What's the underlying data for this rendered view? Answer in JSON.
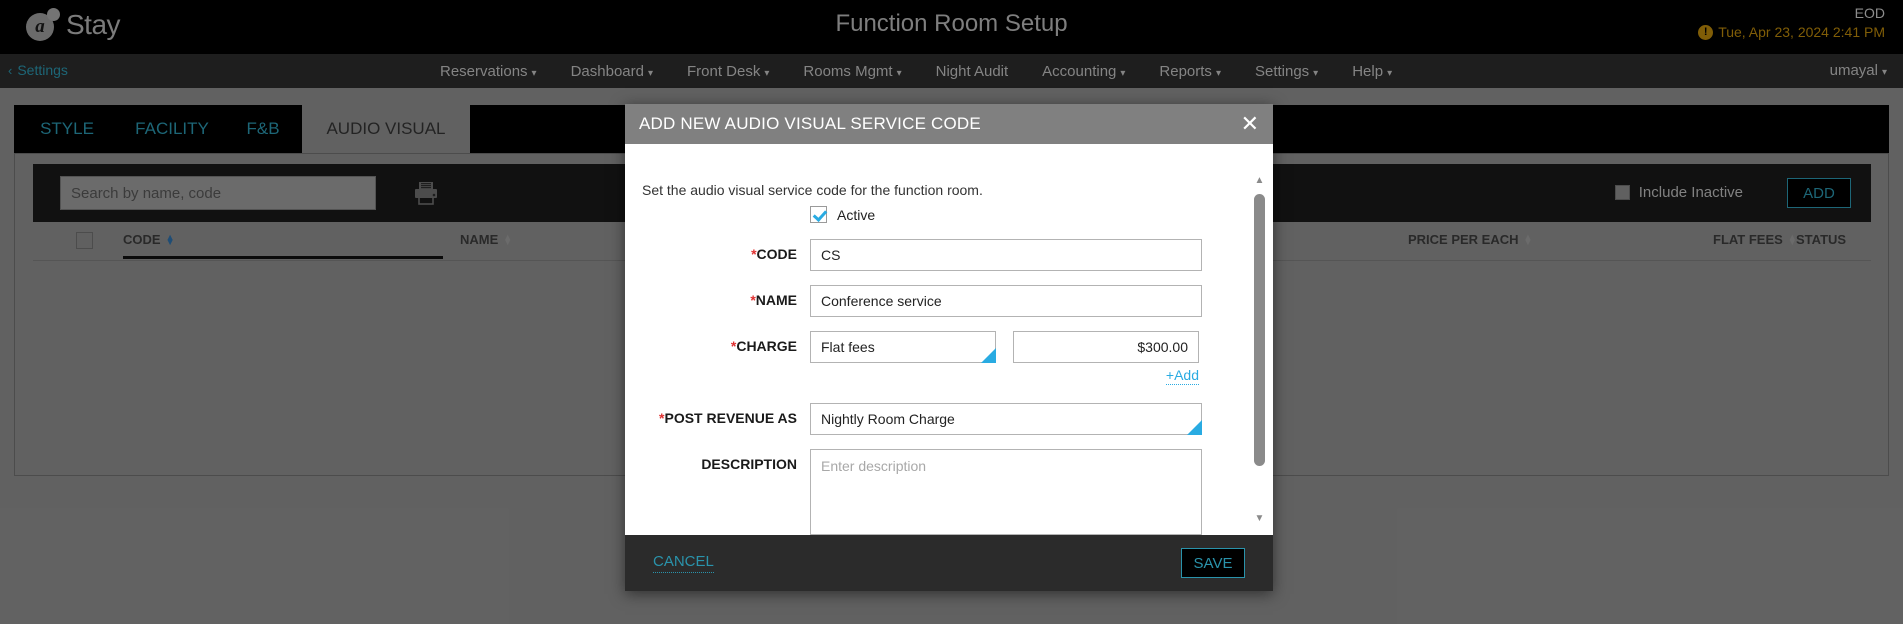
{
  "header": {
    "logo_text": "Stay",
    "logo_glyph": "a",
    "page_title": "Function Room Setup",
    "eod_label": "EOD",
    "eod_date": "Tue, Apr 23, 2024 2:41 PM",
    "warn_glyph": "!"
  },
  "nav": {
    "back_label": "Settings",
    "back_chevron": "‹",
    "items": [
      {
        "label": "Reservations",
        "caret": "▾"
      },
      {
        "label": "Dashboard",
        "caret": "▾"
      },
      {
        "label": "Front Desk",
        "caret": "▾"
      },
      {
        "label": "Rooms Mgmt",
        "caret": "▾"
      },
      {
        "label": "Night Audit",
        "caret": ""
      },
      {
        "label": "Accounting",
        "caret": "▾"
      },
      {
        "label": "Reports",
        "caret": "▾"
      },
      {
        "label": "Settings",
        "caret": "▾"
      },
      {
        "label": "Help",
        "caret": "▾"
      }
    ],
    "user": "umayal",
    "user_caret": "▾"
  },
  "tabs": [
    {
      "label": "STYLE",
      "active": false
    },
    {
      "label": "FACILITY",
      "active": false
    },
    {
      "label": "F&B",
      "active": false
    },
    {
      "label": "AUDIO VISUAL",
      "active": true
    }
  ],
  "toolbar": {
    "search_placeholder": "Search by name, code",
    "search_value": "",
    "include_inactive_label": "Include Inactive",
    "add_label": "ADD"
  },
  "table": {
    "columns": [
      {
        "label": "CODE",
        "sorted": true
      },
      {
        "label": "NAME",
        "sorted": false
      },
      {
        "label": "PRICE PER EACH",
        "sorted": false
      },
      {
        "label": "FLAT FEES",
        "sorted": false
      },
      {
        "label": "STATUS",
        "sorted": false
      }
    ],
    "rows": []
  },
  "modal": {
    "title": "ADD NEW AUDIO VISUAL SERVICE CODE",
    "close_glyph": "✕",
    "intro": "Set the audio visual service code for the function room.",
    "active_label": "Active",
    "active_checked": true,
    "fields": {
      "code_label": "CODE",
      "code_value": "CS",
      "name_label": "NAME",
      "name_value": "Conference service",
      "charge_label": "CHARGE",
      "charge_type": "Flat fees",
      "charge_amount": "$300.00",
      "add_link": "+Add",
      "post_revenue_label": "POST REVENUE AS",
      "post_revenue_value": "Nightly Room Charge",
      "description_label": "DESCRIPTION",
      "description_placeholder": "Enter description",
      "description_value": ""
    },
    "required_mark": "*",
    "cancel_label": "CANCEL",
    "save_label": "SAVE",
    "scroll_up": "▲",
    "scroll_down": "▼"
  },
  "colors": {
    "accent_teal": "#2a93ab",
    "accent_blue": "#29abe2",
    "warn_amber": "#b8860b",
    "required_red": "#e03131"
  }
}
